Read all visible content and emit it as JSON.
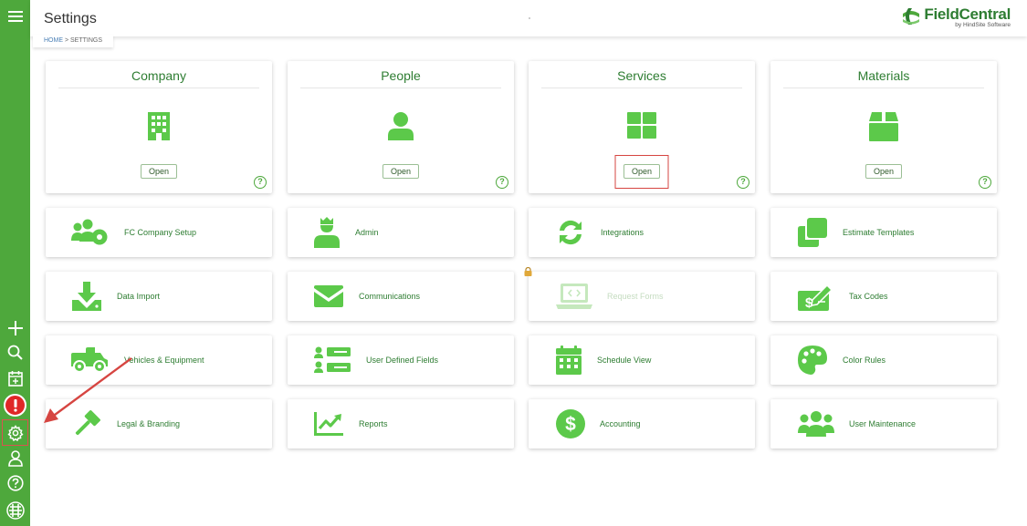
{
  "header": {
    "title": "Settings",
    "logo_name": "FieldCentral",
    "logo_sub": "by HindSite Software"
  },
  "breadcrumb": {
    "home": "HOME",
    "separator": ">",
    "current": "SETTINGS"
  },
  "sidebar": {
    "items": [
      {
        "name": "menu",
        "icon": "hamburger-menu-icon"
      },
      {
        "name": "add",
        "icon": "plus-icon"
      },
      {
        "name": "search",
        "icon": "search-icon"
      },
      {
        "name": "schedule",
        "icon": "calendar-add-icon"
      },
      {
        "name": "alerts",
        "icon": "alert-icon"
      },
      {
        "name": "settings",
        "icon": "gear-icon",
        "selected": true
      },
      {
        "name": "profile",
        "icon": "user-icon"
      },
      {
        "name": "help",
        "icon": "help-icon"
      },
      {
        "name": "brand",
        "icon": "fieldcentral-logo-icon"
      }
    ]
  },
  "big_cards": [
    {
      "title": "Company",
      "icon": "building-icon",
      "open_label": "Open",
      "help": "?"
    },
    {
      "title": "People",
      "icon": "person-icon",
      "open_label": "Open",
      "help": "?"
    },
    {
      "title": "Services",
      "icon": "grid-icon",
      "open_label": "Open",
      "help": "?",
      "highlighted": true
    },
    {
      "title": "Materials",
      "icon": "box-icon",
      "open_label": "Open",
      "help": "?"
    }
  ],
  "tiles": [
    {
      "label": "FC Company Setup",
      "icon": "users-gear-icon"
    },
    {
      "label": "Admin",
      "icon": "admin-crown-icon"
    },
    {
      "label": "Integrations",
      "icon": "sync-icon"
    },
    {
      "label": "Estimate Templates",
      "icon": "copy-icon"
    },
    {
      "label": "Data Import",
      "icon": "download-icon"
    },
    {
      "label": "Communications",
      "icon": "envelope-icon"
    },
    {
      "label": "Request Forms",
      "icon": "laptop-code-icon",
      "disabled": true
    },
    {
      "label": "Tax Codes",
      "icon": "money-pen-icon"
    },
    {
      "label": "Vehicles & Equipment",
      "icon": "truck-icon"
    },
    {
      "label": "User Defined Fields",
      "icon": "user-fields-icon"
    },
    {
      "label": "Schedule View",
      "icon": "calendar-icon"
    },
    {
      "label": "Color Rules",
      "icon": "palette-icon"
    },
    {
      "label": "Legal & Branding",
      "icon": "gavel-icon"
    },
    {
      "label": "Reports",
      "icon": "chart-line-icon"
    },
    {
      "label": "Accounting",
      "icon": "dollar-circle-icon"
    },
    {
      "label": "User Maintenance",
      "icon": "users-icon"
    }
  ],
  "colors": {
    "sidebar": "#4ea83c",
    "icon_green": "#5cc94a",
    "text_green": "#2e7d32",
    "highlight_red": "#d64541"
  }
}
